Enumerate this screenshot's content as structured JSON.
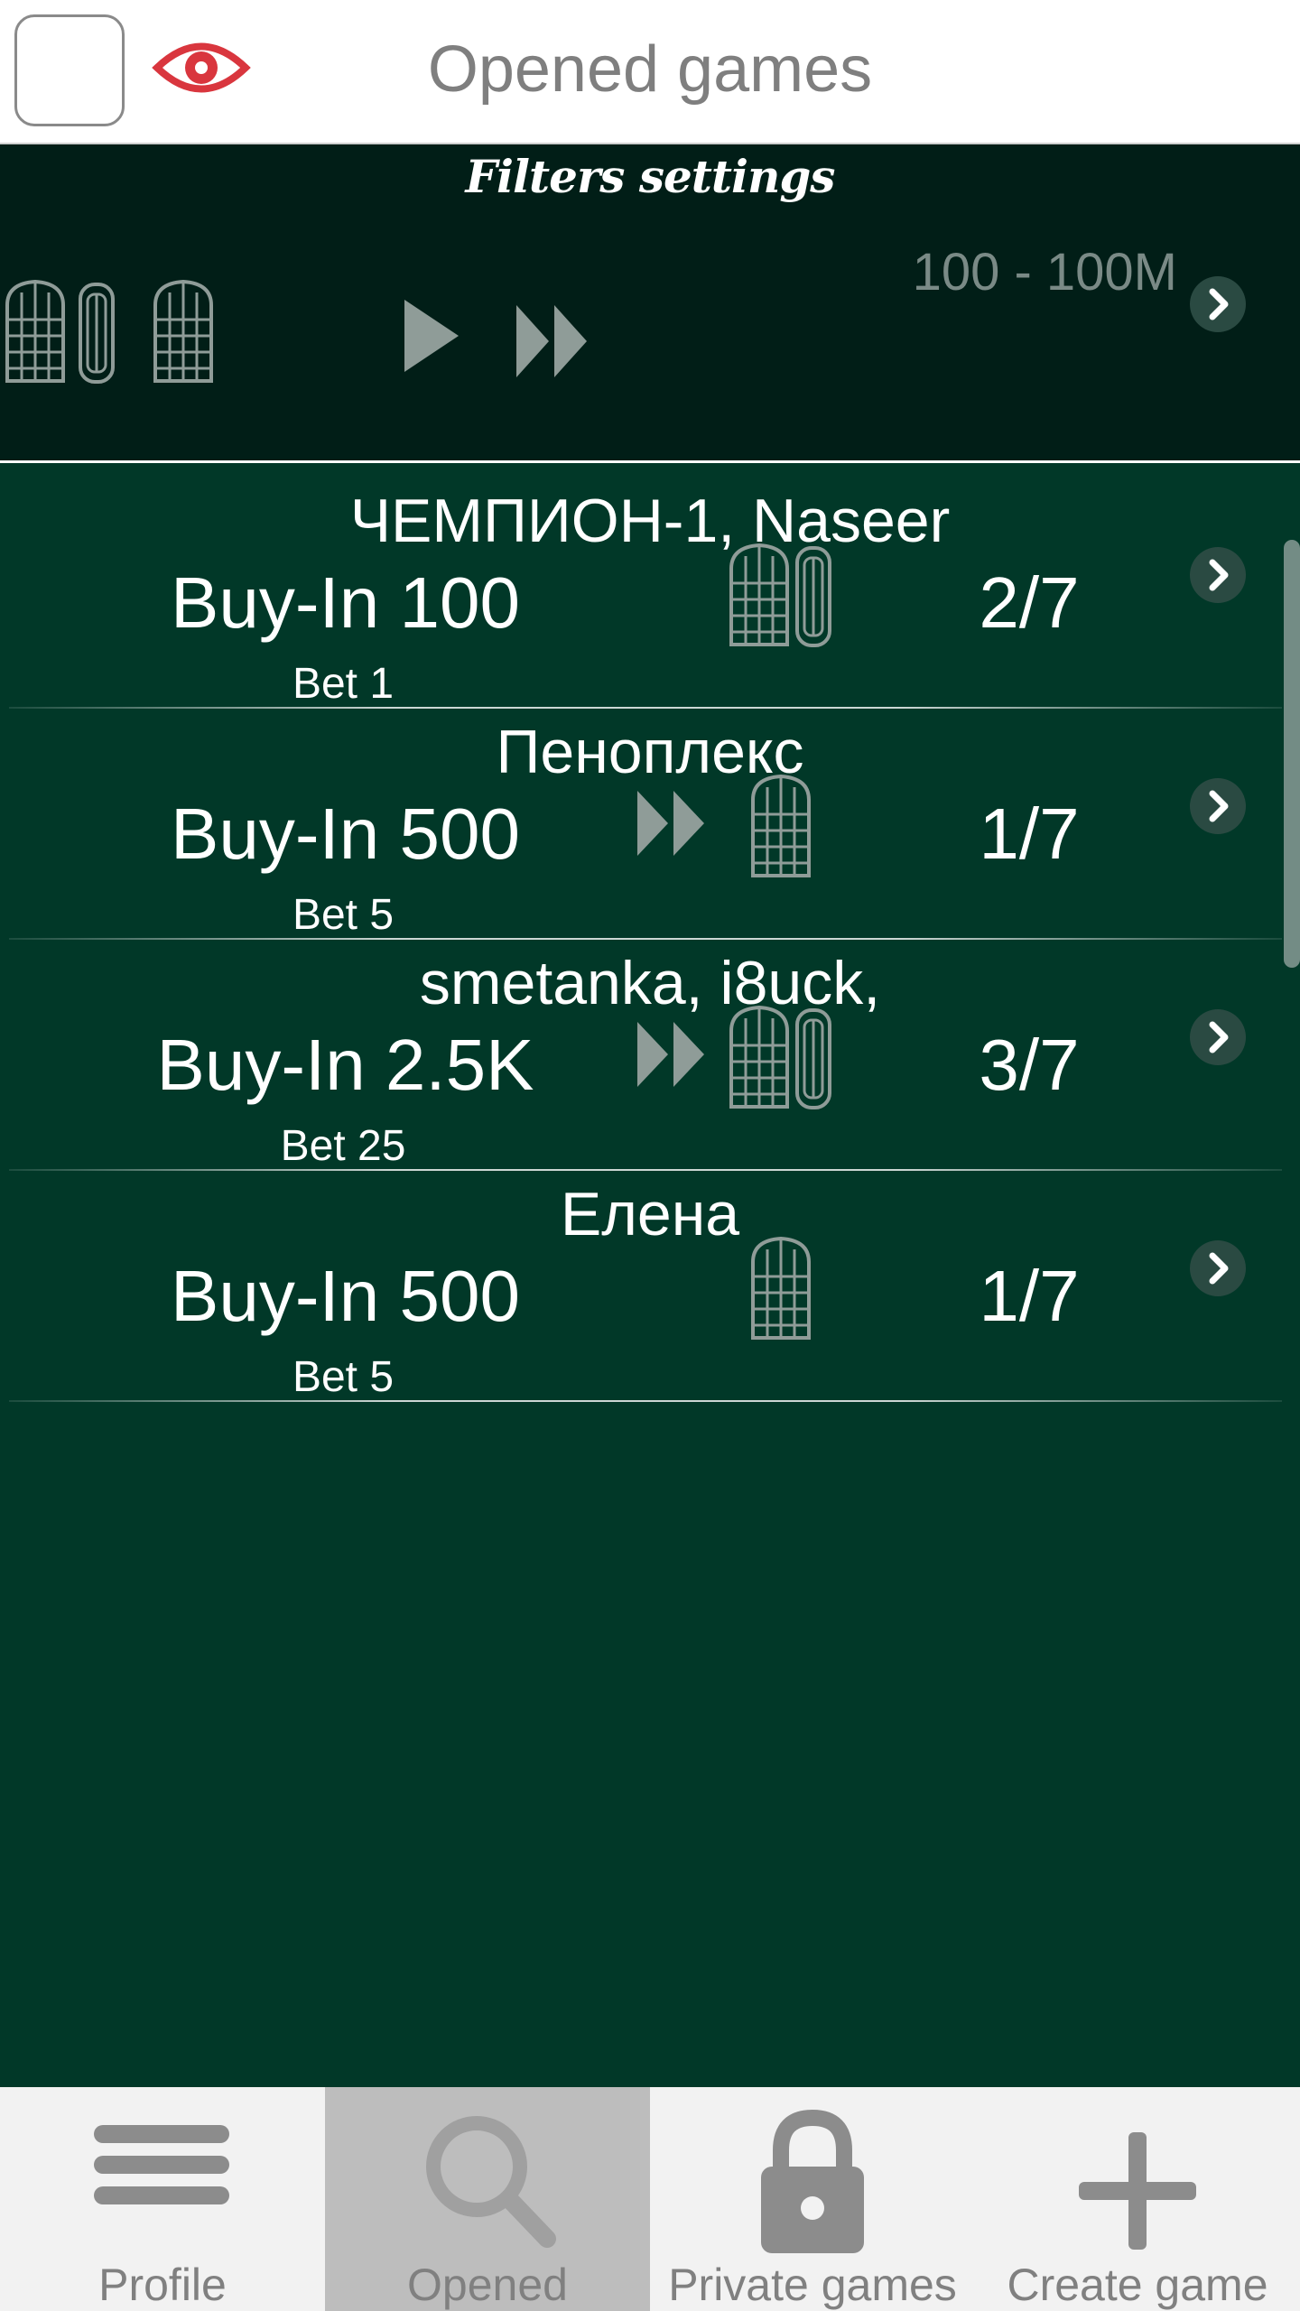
{
  "header": {
    "title": "Opened games",
    "checkbox_checked": false,
    "eye_color": "#d9363e"
  },
  "filters": {
    "title": "Filters settings",
    "range": "100 - 100M",
    "icons": [
      "cards-icon",
      "card-single-icon",
      "play-icon",
      "fast-forward-icon"
    ]
  },
  "games": [
    {
      "players": "ЧЕМПИОН-1, Naseer",
      "buyin": "Buy-In 100",
      "bet": "Bet 1",
      "seats": "2/7",
      "icons": [
        "deck-pair-icon"
      ]
    },
    {
      "players": "Пеноплекс",
      "buyin": "Buy-In 500",
      "bet": "Bet 5",
      "seats": "1/7",
      "icons": [
        "fast-forward-icon",
        "deck-icon"
      ]
    },
    {
      "players": "smetanka, i8uck,",
      "buyin": "Buy-In 2.5K",
      "bet": "Bet 25",
      "seats": "3/7",
      "icons": [
        "fast-forward-icon",
        "deck-pair-icon"
      ]
    },
    {
      "players": "Елена",
      "buyin": "Buy-In 500",
      "bet": "Bet 5",
      "seats": "1/7",
      "icons": [
        "deck-icon"
      ]
    }
  ],
  "nav": {
    "items": [
      {
        "label": "Profile",
        "icon": "menu-icon",
        "active": false
      },
      {
        "label": "Opened",
        "icon": "search-icon",
        "active": true
      },
      {
        "label": "Private games",
        "icon": "lock-icon",
        "active": false
      },
      {
        "label": "Create game",
        "icon": "plus-icon",
        "active": false
      }
    ]
  },
  "colors": {
    "header_bg": "#ffffff",
    "filters_bg": "#011e17",
    "list_bg": "#013828",
    "nav_bg": "#f2f2f2",
    "nav_active_bg": "#bdbdbd"
  }
}
